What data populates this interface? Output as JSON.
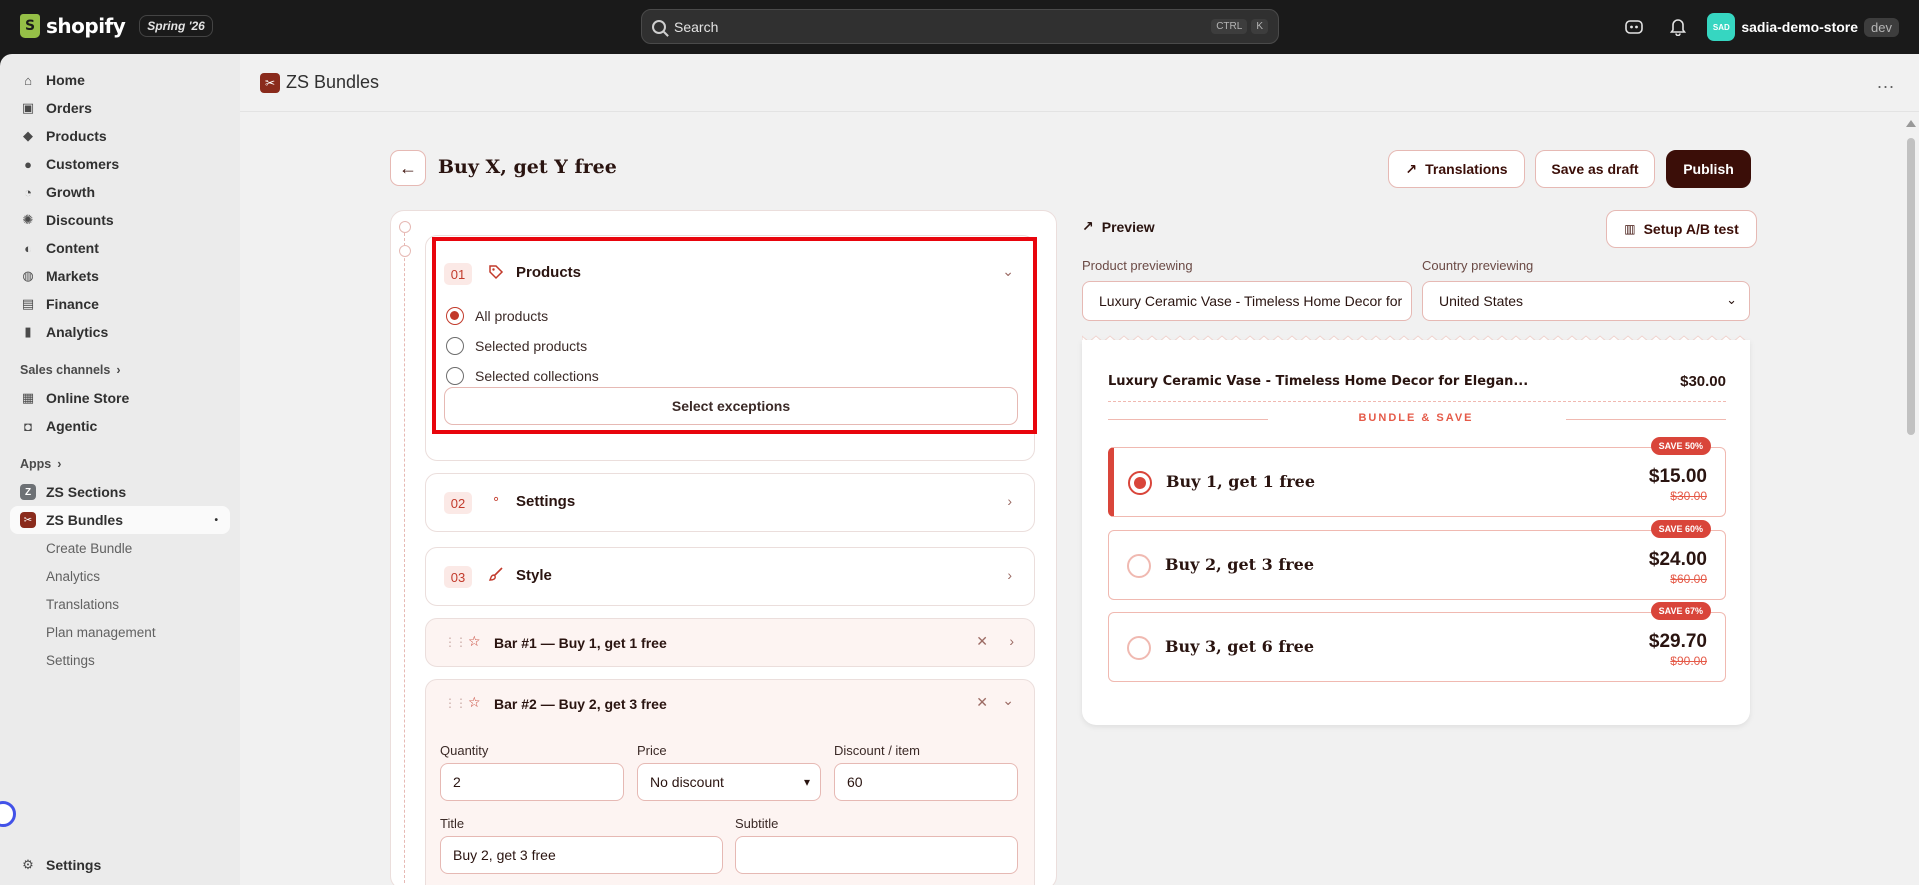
{
  "topbar": {
    "brand": "shopify",
    "edition": "Spring '26",
    "search_label": "Search",
    "shortcut_ctrl": "CTRL",
    "shortcut_key": "K",
    "store_initials": "SAD",
    "store_name": "sadia-demo-store",
    "env_badge": "dev"
  },
  "sidebar": {
    "items": [
      {
        "label": "Home",
        "icon": "home-icon"
      },
      {
        "label": "Orders",
        "icon": "inbox-icon"
      },
      {
        "label": "Products",
        "icon": "tag-icon"
      },
      {
        "label": "Customers",
        "icon": "person-icon"
      },
      {
        "label": "Growth",
        "icon": "growth-icon"
      },
      {
        "label": "Discounts",
        "icon": "discount-icon"
      },
      {
        "label": "Content",
        "icon": "content-icon"
      },
      {
        "label": "Markets",
        "icon": "globe-icon"
      },
      {
        "label": "Finance",
        "icon": "bank-icon"
      },
      {
        "label": "Analytics",
        "icon": "bar-chart-icon"
      }
    ],
    "sales_channels_label": "Sales channels",
    "channels": [
      {
        "label": "Online Store",
        "icon": "store-icon"
      },
      {
        "label": "Agentic",
        "icon": "agentic-icon"
      }
    ],
    "apps_label": "Apps",
    "apps": [
      {
        "label": "ZS Sections"
      },
      {
        "label": "ZS Bundles",
        "marker": "•"
      }
    ],
    "sub_items": [
      "Create Bundle",
      "Analytics",
      "Translations",
      "Plan management",
      "Settings"
    ],
    "settings_label": "Settings"
  },
  "appbar": {
    "title": "ZS Bundles",
    "more": "..."
  },
  "page": {
    "back": "←",
    "title": "Buy X, get Y free",
    "translations_label": "Translations",
    "save_draft_label": "Save as draft",
    "publish_label": "Publish"
  },
  "editor": {
    "products": {
      "num": "01",
      "title": "Products",
      "options": [
        "All products",
        "Selected products",
        "Selected collections"
      ],
      "selected_index": 0,
      "exceptions_label": "Select exceptions"
    },
    "settings": {
      "num": "02",
      "title": "Settings"
    },
    "style": {
      "num": "03",
      "title": "Style"
    },
    "bar1": {
      "title": "Bar #1 — Buy 1, get 1 free"
    },
    "bar2": {
      "title": "Bar #2 — Buy 2, get 3 free",
      "quantity_label": "Quantity",
      "quantity_value": "2",
      "price_label": "Price",
      "price_value": "No discount",
      "discount_label": "Discount / item",
      "discount_value": "60",
      "title_label": "Title",
      "title_value": "Buy 2, get 3 free",
      "subtitle_label": "Subtitle",
      "subtitle_value": ""
    }
  },
  "preview": {
    "heading": "Preview",
    "ab_label": "Setup A/B test",
    "product_label": "Product previewing",
    "product_value": "Luxury Ceramic Vase - Timeless Home Decor for",
    "country_label": "Country previewing",
    "country_value": "United States",
    "product_name": "Luxury Ceramic Vase - Timeless Home Decor for Elegan...",
    "product_price": "$30.00",
    "bundle_label": "BUNDLE & SAVE",
    "offers": [
      {
        "title": "Buy 1, get 1 free",
        "price": "$15.00",
        "old": "$30.00",
        "badge": "SAVE 50%"
      },
      {
        "title": "Buy 2, get 3 free",
        "price": "$24.00",
        "old": "$60.00",
        "badge": "SAVE 60%"
      },
      {
        "title": "Buy 3, get 6 free",
        "price": "$29.70",
        "old": "$90.00",
        "badge": "SAVE 67%"
      }
    ],
    "selected_offer": 0
  },
  "colors": {
    "accent": "#c23a2b",
    "publish_bg": "#3b0e08",
    "highlight": "#e8050d"
  }
}
